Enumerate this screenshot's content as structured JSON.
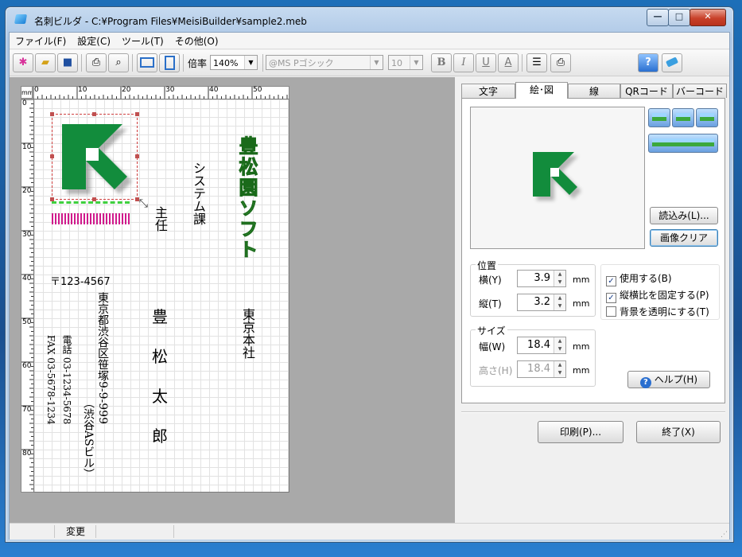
{
  "window": {
    "title": "名刺ビルダ - C:¥Program Files¥MeisiBuilder¥sample2.meb"
  },
  "menu": [
    "ファイル(F)",
    "設定(C)",
    "ツール(T)",
    "その他(O)"
  ],
  "toolbar": {
    "zoom_label": "倍率",
    "zoom_value": "140%",
    "font_name": "@MS Pゴシック",
    "font_size": "10",
    "bold": "B",
    "italic": "I",
    "underline": "U",
    "color": "A"
  },
  "ruler": {
    "unit": "mm",
    "h_ticks": [
      "0",
      "10",
      "20",
      "30",
      "40",
      "50"
    ],
    "v_ticks": [
      "0",
      "10",
      "20",
      "30",
      "40",
      "50",
      "60",
      "70",
      "80"
    ]
  },
  "card": {
    "company": "豊松園ソフト",
    "department": "システム課",
    "position": "主任",
    "name": [
      "豊",
      "松",
      "太",
      "郎"
    ],
    "branch": "東京本社",
    "postal": "〒123-4567",
    "address1": "東京都渋谷区笹塚9-9-999",
    "address2": "（渋谷ASビル）",
    "tel": "電話 03-1234-5678",
    "fax": "FAX 03-5678-1234"
  },
  "tabs": [
    "文字",
    "絵･図",
    "線",
    "QRコード",
    "バーコード"
  ],
  "active_tab": "絵･図",
  "image_panel": {
    "load_button": "読込み(L)...",
    "clear_button": "画像クリア",
    "position_group": "位置",
    "x_label": "横(Y)",
    "x_value": "3.9",
    "y_label": "縦(T)",
    "y_value": "3.2",
    "size_group": "サイズ",
    "w_label": "幅(W)",
    "w_value": "18.4",
    "h_label": "高さ(H)",
    "h_value": "18.4",
    "unit": "mm",
    "checkboxes": [
      {
        "label": "使用する(B)",
        "checked": true
      },
      {
        "label": "縦横比を固定する(P)",
        "checked": true
      },
      {
        "label": "背景を透明にする(T)",
        "checked": false
      }
    ],
    "help_button": "ヘルプ(H)"
  },
  "bottom_buttons": {
    "print": "印刷(P)...",
    "exit": "終了(X)"
  },
  "status": {
    "modified": "変更"
  },
  "colors": {
    "logo_green": "#128c3c",
    "company_green": "#7fe07a",
    "accent_pink": "#d01a8c"
  }
}
